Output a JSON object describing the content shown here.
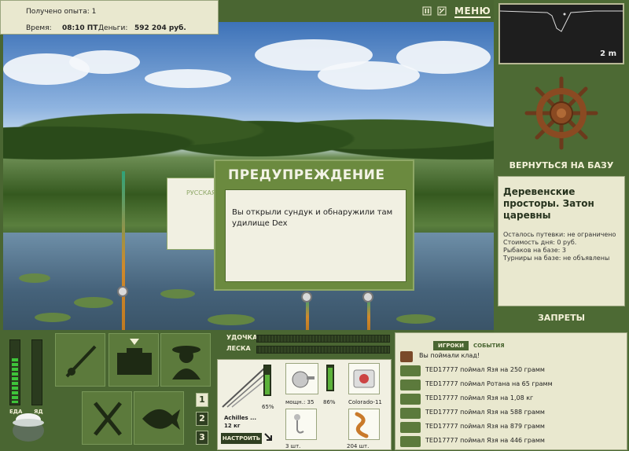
{
  "info": {
    "experience_label": "Получено опыта: 1",
    "time_label": "Время:",
    "time_value": "08:10 ПТ",
    "money_label": "Деньги:",
    "money_value": "592 204 руб."
  },
  "top_controls": {
    "pause_icon": "pause-icon",
    "settings_icon": "settings-icon",
    "menu_label": "МЕНЮ"
  },
  "depth": {
    "value": "2 m"
  },
  "right_panel": {
    "return_label": "ВЕРНУТЬСЯ НА БАЗУ",
    "location_name": "Деревенские просторы. Затон царевны",
    "stats": [
      "Осталось путевки: не ограничено",
      "Стоимость дня: 0 руб.",
      "Рыбаков на базе: 3",
      "Турниры на базе: не объявлены"
    ],
    "bans_label": "ЗАПРЕТЫ"
  },
  "modal": {
    "title": "ПРЕДУПРЕЖДЕНИЕ",
    "message": "Вы открыли сундук и обнаружили там удилище Dex",
    "background_dialog_label": "РУССКАЯ"
  },
  "status_gauges": [
    {
      "label": "ЕДА",
      "level": 0.7
    },
    {
      "label": "ЯД",
      "level": 0.0
    }
  ],
  "action_slots": [
    {
      "icon": "rod-icon"
    },
    {
      "icon": "tackle-box-icon"
    },
    {
      "icon": "fisherman-icon"
    },
    {
      "icon": "knife-fork-icon"
    },
    {
      "icon": "fish-icon"
    }
  ],
  "rod_slots": [
    "1",
    "2",
    "3"
  ],
  "tackle": {
    "rod_label": "УДОЧКА",
    "line_label": "ЛЕСКА",
    "rod_percent": "65%",
    "rod_name": "Achilles ...",
    "rod_weight": "12 кг",
    "reel_power": "мощн.: 35",
    "reel_percent": "86%",
    "line_name": "Colorado-11",
    "hook_count": "3 шт.",
    "bait_count": "204 шт.",
    "setup_label": "НАСТРОИТЬ",
    "rod_condition": 0.65,
    "reel_condition": 0.86
  },
  "events": {
    "tabs": [
      "ИГРОКИ",
      "СОБЫТИЯ"
    ],
    "active_tab": 0,
    "items": [
      {
        "icon": "chest-icon",
        "text": "Вы поймали клад!"
      },
      {
        "icon": "fish-icon",
        "text": "TED17777 поймал Язя на 250 грамм"
      },
      {
        "icon": "fish-icon",
        "text": "TED17777 поймал Ротана на 65 грамм"
      },
      {
        "icon": "fish-icon",
        "text": "TED17777 поймал Язя на 1,08 кг"
      },
      {
        "icon": "fish-icon",
        "text": "TED17777 поймал Язя на 588 грамм"
      },
      {
        "icon": "fish-icon",
        "text": "TED17777 поймал Язя на 879 грамм"
      },
      {
        "icon": "fish-icon",
        "text": "TED17777 поймал Язя на 446 грамм"
      }
    ]
  },
  "colors": {
    "panel_green": "#4a6632",
    "cream": "#e9e8cf",
    "gauge_green": "#3ec43a"
  }
}
